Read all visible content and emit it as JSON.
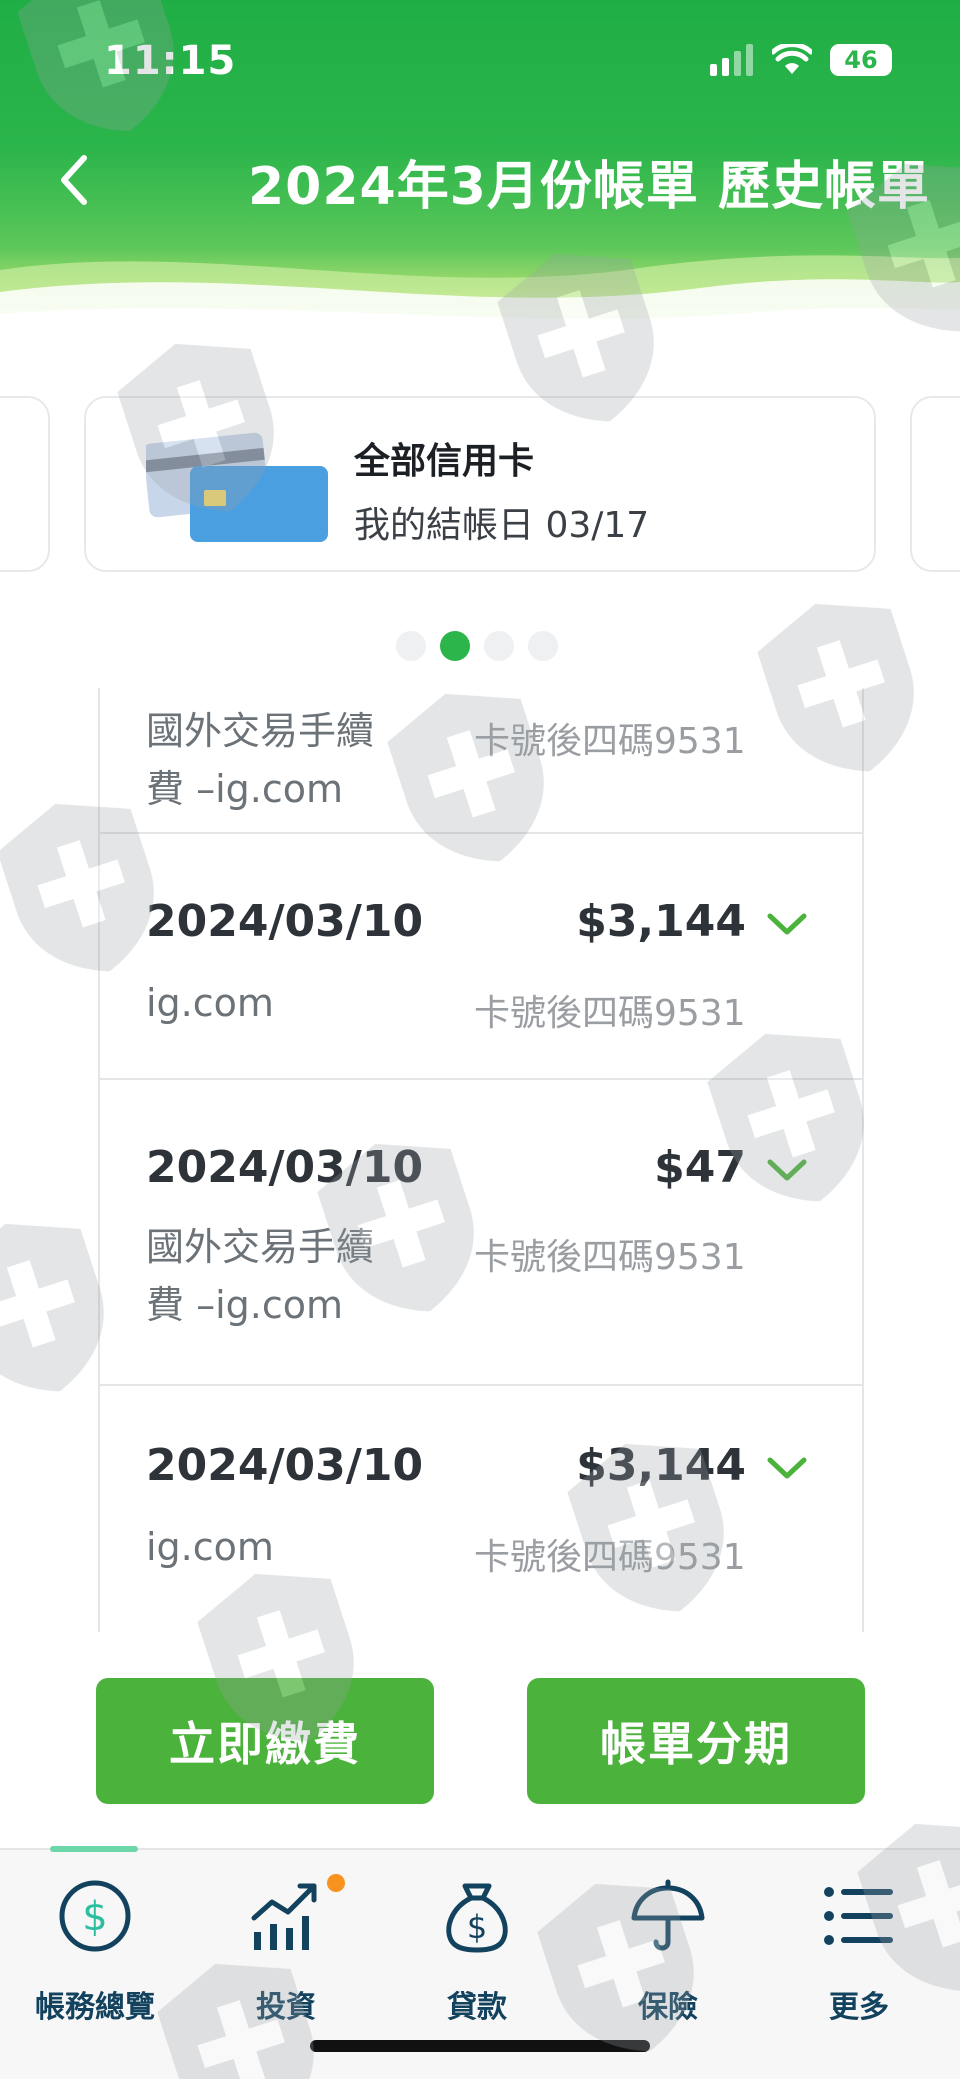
{
  "status_bar": {
    "time": "11:15",
    "battery": "46"
  },
  "header": {
    "title": "2024年3月份帳單 歷史帳單"
  },
  "card_selector": {
    "title": "全部信用卡",
    "closing_day": "我的結帳日 03/17",
    "page_count": 4,
    "active_page": 2
  },
  "transactions": [
    {
      "date": "",
      "amount": "",
      "merchant_line1": "國外交易手續",
      "merchant_line2": "費 –ig.com",
      "card": "卡號後四碼9531"
    },
    {
      "date": "2024/03/10",
      "amount": "$3,144",
      "merchant_line1": "ig.com",
      "merchant_line2": "",
      "card": "卡號後四碼9531"
    },
    {
      "date": "2024/03/10",
      "amount": "$47",
      "merchant_line1": "國外交易手續",
      "merchant_line2": "費 –ig.com",
      "card": "卡號後四碼9531"
    },
    {
      "date": "2024/03/10",
      "amount": "$3,144",
      "merchant_line1": "ig.com",
      "merchant_line2": "",
      "card": "卡號後四碼9531"
    }
  ],
  "actions": {
    "pay_now": "立即繳費",
    "installment": "帳單分期"
  },
  "tabs": [
    {
      "label": "帳務總覽",
      "icon": "dollar-circle-icon",
      "active": true
    },
    {
      "label": "投資",
      "icon": "investment-chart-icon",
      "badge": true
    },
    {
      "label": "貸款",
      "icon": "money-bag-icon"
    },
    {
      "label": "保險",
      "icon": "umbrella-icon"
    },
    {
      "label": "更多",
      "icon": "menu-list-icon"
    }
  ],
  "colors": {
    "brand_green": "#2bb54b",
    "button_green": "#4bb23b",
    "tab_text": "#13425e",
    "badge_orange": "#f7931e"
  }
}
